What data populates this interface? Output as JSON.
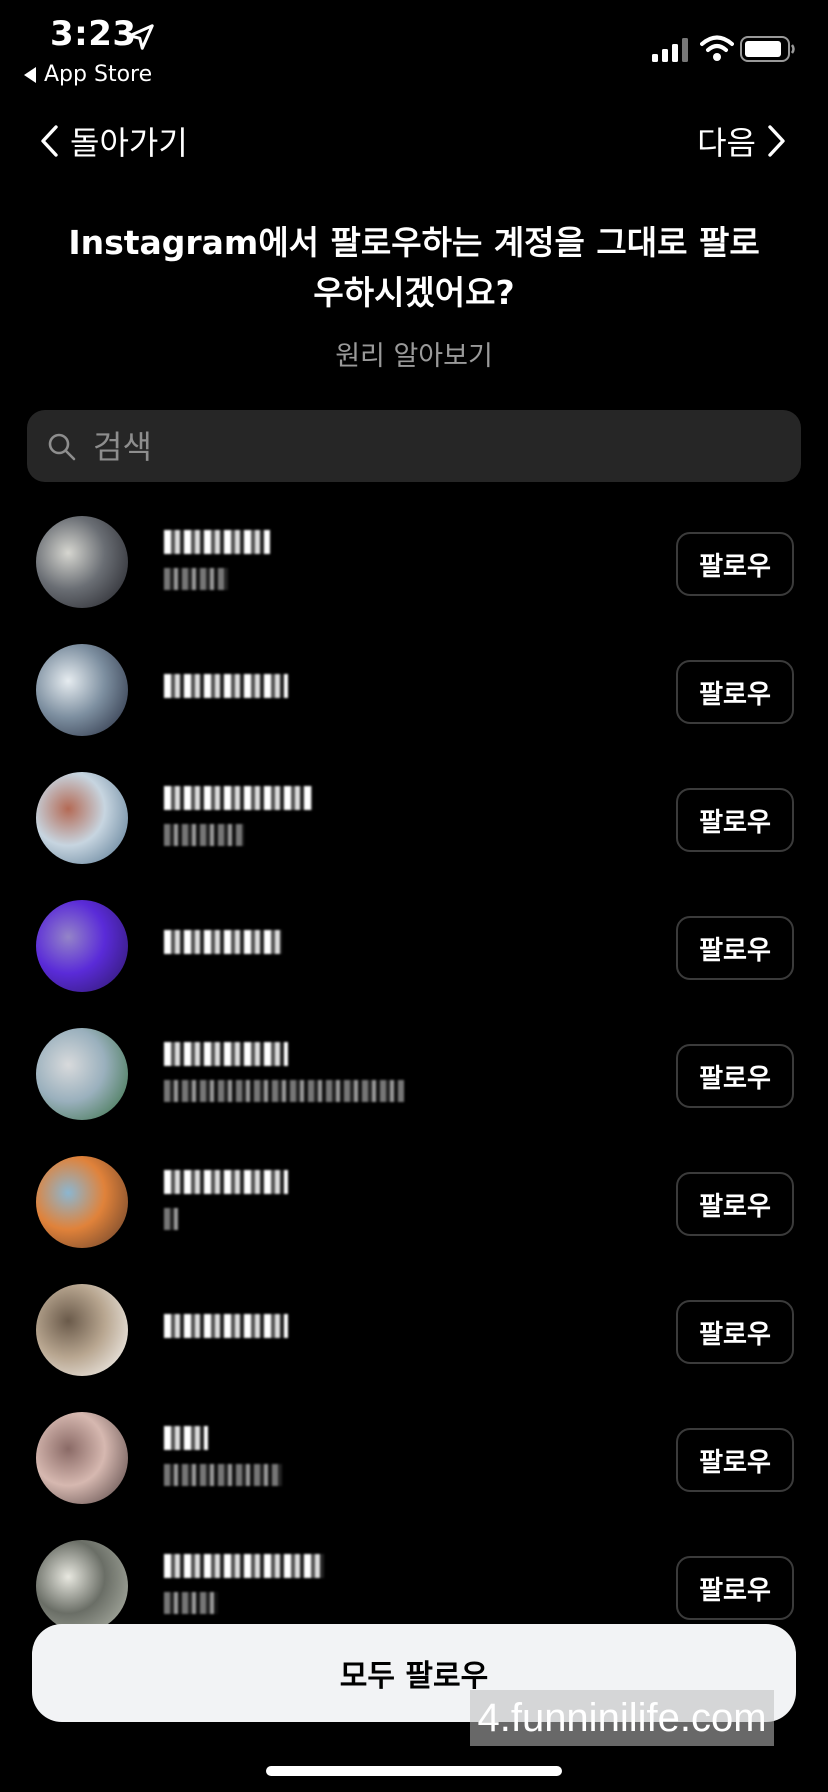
{
  "status_bar": {
    "time": "3:23",
    "back_app": "App Store"
  },
  "nav": {
    "back_label": "돌아가기",
    "next_label": "다음"
  },
  "heading": "Instagram에서 팔로우하는 계정을 그대로 팔로우하시겠어요?",
  "learn_more": "원리 알아보기",
  "search": {
    "placeholder": "검색"
  },
  "accounts": [
    {
      "avatar_colors": [
        "#1c1c22",
        "#6a6e74",
        "#d6d6d0"
      ],
      "has_sub": true,
      "follow_label": "팔로우"
    },
    {
      "avatar_colors": [
        "#1f2538",
        "#7d8fa0",
        "#e6ecf0"
      ],
      "has_sub": false,
      "follow_label": "팔로우"
    },
    {
      "avatar_colors": [
        "#4d6f8a",
        "#c7d5e0",
        "#b46a55"
      ],
      "has_sub": true,
      "follow_label": "팔로우"
    },
    {
      "avatar_colors": [
        "#2b1760",
        "#5a2bd8",
        "#9484c8"
      ],
      "has_sub": false,
      "follow_label": "팔로우"
    },
    {
      "avatar_colors": [
        "#2f6a3a",
        "#9ab0bd",
        "#d8dadc"
      ],
      "has_sub": true,
      "follow_label": "팔로우"
    },
    {
      "avatar_colors": [
        "#5a3a2a",
        "#e0823a",
        "#8cb6d0"
      ],
      "has_sub": true,
      "follow_label": "팔로우"
    },
    {
      "avatar_colors": [
        "#ffffff",
        "#b8a690",
        "#6a5a4a"
      ],
      "has_sub": false,
      "follow_label": "팔로우"
    },
    {
      "avatar_colors": [
        "#4a3a3a",
        "#d6b8b0",
        "#8a6a66"
      ],
      "has_sub": true,
      "follow_label": "팔로우"
    },
    {
      "avatar_colors": [
        "#b8bcb0",
        "#6a6e66",
        "#e8e8e0"
      ],
      "has_sub": true,
      "follow_label": "팔로우"
    }
  ],
  "follow_all_label": "모두 팔로우",
  "watermark": "4.funninilife.com"
}
